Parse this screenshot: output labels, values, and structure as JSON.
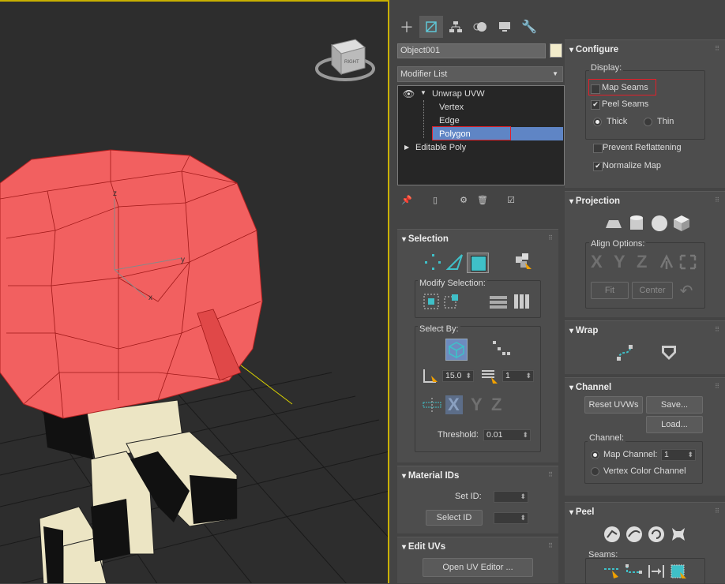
{
  "viewport": {
    "viewcube_label": "RIGHT",
    "axis_labels": {
      "z": "z",
      "y": "y",
      "x": "x"
    }
  },
  "toolbar_tabs": [
    {
      "name": "create-tab",
      "icon": "plus-icon"
    },
    {
      "name": "modify-tab",
      "icon": "modify-icon"
    },
    {
      "name": "hierarchy-tab",
      "icon": "hierarchy-icon"
    },
    {
      "name": "motion-tab",
      "icon": "motion-icon"
    },
    {
      "name": "display-tab",
      "icon": "display-icon"
    },
    {
      "name": "utilities-tab",
      "icon": "wrench-icon"
    }
  ],
  "object_name": "Object001",
  "object_color": "#f2eccb",
  "modifier_list_label": "Modifier List",
  "stack": {
    "unwrap": "Unwrap UVW",
    "vertex": "Vertex",
    "edge": "Edge",
    "polygon": "Polygon",
    "editable_poly": "Editable Poly"
  },
  "selection": {
    "title": "Selection",
    "modify_selection_label": "Modify Selection:",
    "select_by_label": "Select By:",
    "angle_value": "15.0",
    "elements_value": "1",
    "threshold_label": "Threshold:",
    "threshold_value": "0.01",
    "axes": {
      "x": "X",
      "y": "Y",
      "z": "Z"
    }
  },
  "material_ids": {
    "title": "Material IDs",
    "set_id_label": "Set ID:",
    "select_id_button": "Select ID"
  },
  "edit_uvs": {
    "title": "Edit UVs",
    "open_uv_editor_button": "Open UV Editor ..."
  },
  "configure": {
    "title": "Configure",
    "display_label": "Display:",
    "map_seams": "Map Seams",
    "peel_seams": "Peel Seams",
    "thick": "Thick",
    "thin": "Thin",
    "prevent_reflattening": "Prevent Reflattening",
    "normalize_map": "Normalize Map"
  },
  "projection": {
    "title": "Projection",
    "align_options_label": "Align Options:",
    "axes": {
      "x": "X",
      "y": "Y",
      "z": "Z"
    },
    "fit_button": "Fit",
    "center_button": "Center"
  },
  "wrap": {
    "title": "Wrap"
  },
  "channel": {
    "title": "Channel",
    "reset_uvws_button": "Reset UVWs",
    "save_button": "Save...",
    "load_button": "Load...",
    "channel_label": "Channel:",
    "map_channel": "Map Channel:",
    "map_channel_value": "1",
    "vertex_color_channel": "Vertex Color Channel"
  },
  "peel": {
    "title": "Peel",
    "seams_label": "Seams:"
  },
  "colors": {
    "accent_teal": "#3fc0c8",
    "selection_red": "#f26060",
    "highlight_box": "#e0202a",
    "viewport_border": "#c8b000"
  }
}
